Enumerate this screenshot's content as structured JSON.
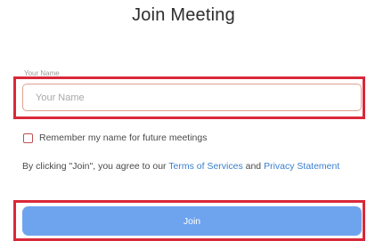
{
  "dialog": {
    "title": "Join Meeting",
    "name_field": {
      "label": "Your Name",
      "placeholder": "Your Name",
      "value": ""
    },
    "remember": {
      "label": "Remember my name for future meetings",
      "checked": false
    },
    "agreement": {
      "prefix": "By clicking \"Join\", you agree to our ",
      "terms_link": "Terms of Services",
      "conjunction": " and ",
      "privacy_link": "Privacy Statement"
    },
    "join_button": {
      "label": "Join"
    }
  },
  "colors": {
    "highlight": "#d9283a",
    "join_button_bg": "#6ea4ee",
    "link": "#3a7fcf"
  }
}
